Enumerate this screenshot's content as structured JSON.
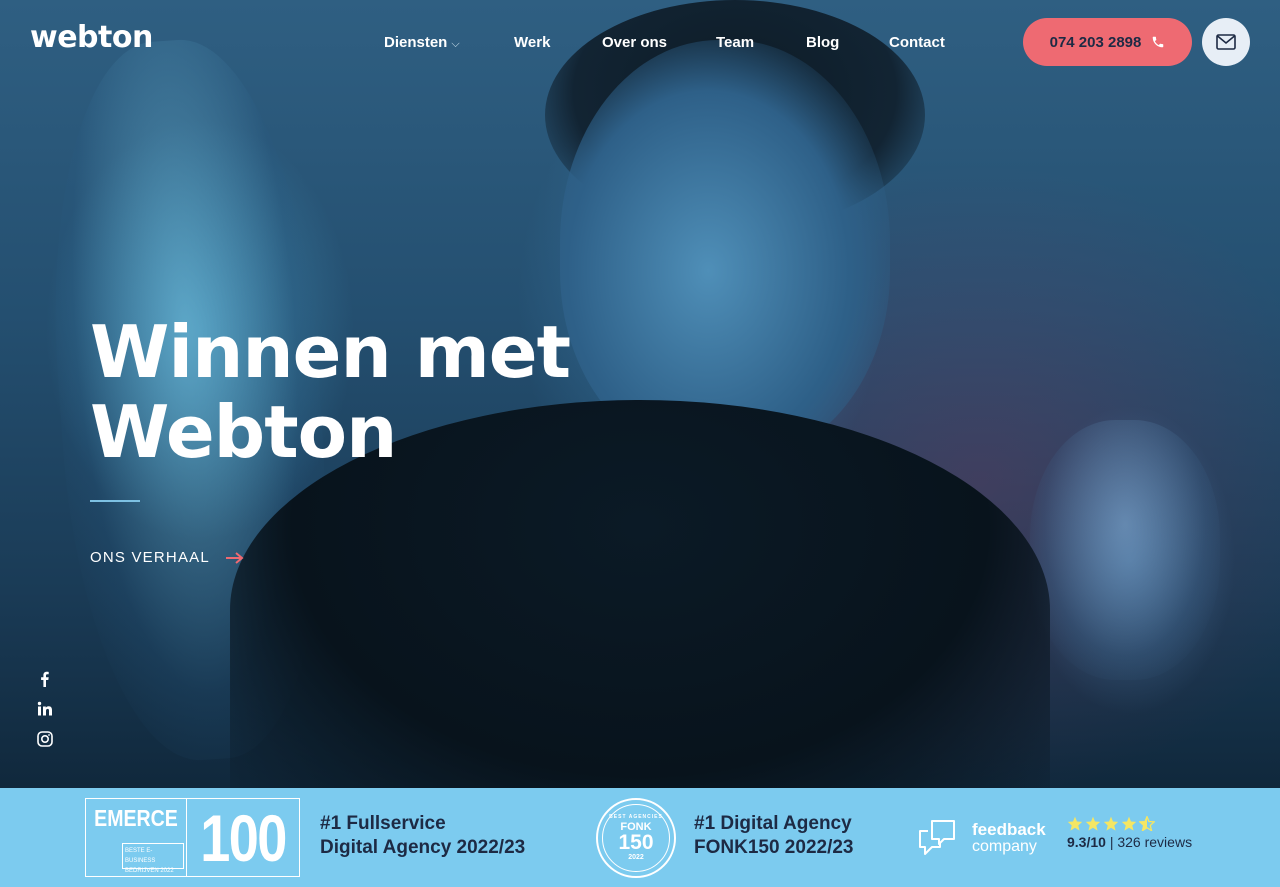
{
  "header": {
    "logo": "webton",
    "nav": [
      {
        "label": "Diensten",
        "has_dropdown": true
      },
      {
        "label": "Werk"
      },
      {
        "label": "Over ons"
      },
      {
        "label": "Team"
      },
      {
        "label": "Blog"
      },
      {
        "label": "Contact"
      }
    ],
    "phone_label": "074 203 2898",
    "phone_icon": "phone-icon",
    "mail_icon": "envelope-icon"
  },
  "hero": {
    "headline_line1": "Winnen met",
    "headline_line2": "Webton",
    "cta_label": "ONS VERHAAL",
    "cta_icon": "arrow-right-icon"
  },
  "social": [
    {
      "icon": "facebook-icon"
    },
    {
      "icon": "linkedin-icon"
    },
    {
      "icon": "instagram-icon"
    }
  ],
  "awards": {
    "emerce": {
      "logo_word": "EMERCE",
      "logo_sub": "BESTE E-BUSINESS BEDRIJVEN 2022",
      "logo_num": "100",
      "line1": "#1 Fullservice",
      "line2": "Digital Agency 2022/23"
    },
    "fonk": {
      "logo_ring": "BEST AGENCIES",
      "logo_name": "FONK",
      "logo_num": "150",
      "logo_year": "2022",
      "line1": "#1 Digital Agency",
      "line2": "FONK150 2022/23"
    },
    "feedback": {
      "logo_word1": "feedback",
      "logo_word2": "company",
      "stars": 4.5,
      "score": "9.3/10",
      "separator": " | ",
      "reviews": "326 reviews"
    }
  },
  "colors": {
    "accent": "#ee6a72",
    "awards_bar": "#7ccbef",
    "dark_text": "#1d2a44"
  }
}
